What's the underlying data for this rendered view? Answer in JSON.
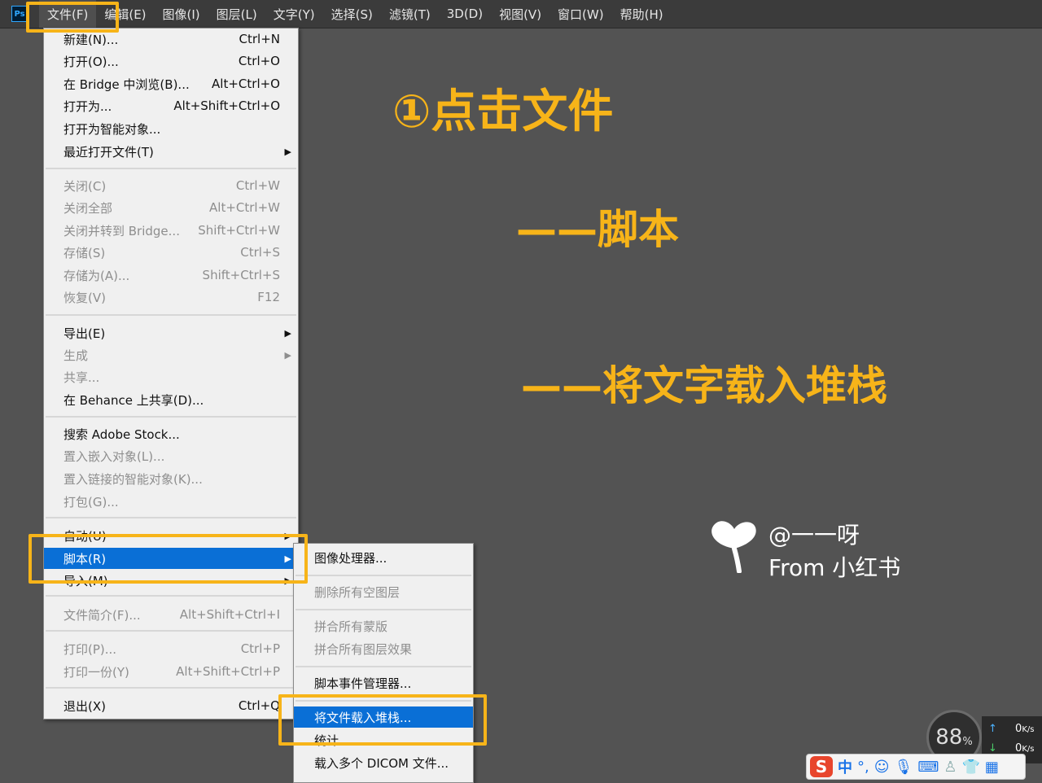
{
  "menubar": {
    "logo": "Ps",
    "items": [
      "文件(F)",
      "编辑(E)",
      "图像(I)",
      "图层(L)",
      "文字(Y)",
      "选择(S)",
      "滤镜(T)",
      "3D(D)",
      "视图(V)",
      "窗口(W)",
      "帮助(H)"
    ]
  },
  "file_menu": {
    "items": [
      {
        "label": "新建(N)...",
        "shortcut": "Ctrl+N"
      },
      {
        "label": "打开(O)...",
        "shortcut": "Ctrl+O"
      },
      {
        "label": "在 Bridge 中浏览(B)...",
        "shortcut": "Alt+Ctrl+O"
      },
      {
        "label": "打开为...",
        "shortcut": "Alt+Shift+Ctrl+O"
      },
      {
        "label": "打开为智能对象...",
        "shortcut": ""
      },
      {
        "label": "最近打开文件(T)",
        "shortcut": ""
      },
      {
        "label": "关闭(C)",
        "shortcut": "Ctrl+W"
      },
      {
        "label": "关闭全部",
        "shortcut": "Alt+Ctrl+W"
      },
      {
        "label": "关闭并转到 Bridge...",
        "shortcut": "Shift+Ctrl+W"
      },
      {
        "label": "存储(S)",
        "shortcut": "Ctrl+S"
      },
      {
        "label": "存储为(A)...",
        "shortcut": "Shift+Ctrl+S"
      },
      {
        "label": "恢复(V)",
        "shortcut": "F12"
      },
      {
        "label": "导出(E)",
        "shortcut": ""
      },
      {
        "label": "生成",
        "shortcut": ""
      },
      {
        "label": "共享...",
        "shortcut": ""
      },
      {
        "label": "在 Behance 上共享(D)...",
        "shortcut": ""
      },
      {
        "label": "搜索 Adobe Stock...",
        "shortcut": ""
      },
      {
        "label": "置入嵌入对象(L)...",
        "shortcut": ""
      },
      {
        "label": "置入链接的智能对象(K)...",
        "shortcut": ""
      },
      {
        "label": "打包(G)...",
        "shortcut": ""
      },
      {
        "label": "自动(U)",
        "shortcut": ""
      },
      {
        "label": "脚本(R)",
        "shortcut": ""
      },
      {
        "label": "导入(M)",
        "shortcut": ""
      },
      {
        "label": "文件简介(F)...",
        "shortcut": "Alt+Shift+Ctrl+I"
      },
      {
        "label": "打印(P)...",
        "shortcut": "Ctrl+P"
      },
      {
        "label": "打印一份(Y)",
        "shortcut": "Alt+Shift+Ctrl+P"
      },
      {
        "label": "退出(X)",
        "shortcut": "Ctrl+Q"
      }
    ]
  },
  "script_menu": {
    "items": [
      "图像处理器...",
      "删除所有空图层",
      "拼合所有蒙版",
      "拼合所有图层效果",
      "脚本事件管理器...",
      "将文件载入堆栈...",
      "统计...",
      "载入多个 DICOM 文件..."
    ]
  },
  "annotations": {
    "step1": "①点击文件",
    "step2": "——脚本",
    "step3": "——将文字载入堆栈"
  },
  "watermark": {
    "handle": "@一一呀",
    "source": "From 小红书"
  },
  "system": {
    "speed_percent": "88",
    "speed_unit": "%",
    "upload": "0",
    "download": "0",
    "rate_unit": "K/s",
    "ime_mode": "中"
  },
  "colors": {
    "annotation": "#f7b419",
    "menu_highlight": "#0a6fd6",
    "canvas": "#535353"
  }
}
